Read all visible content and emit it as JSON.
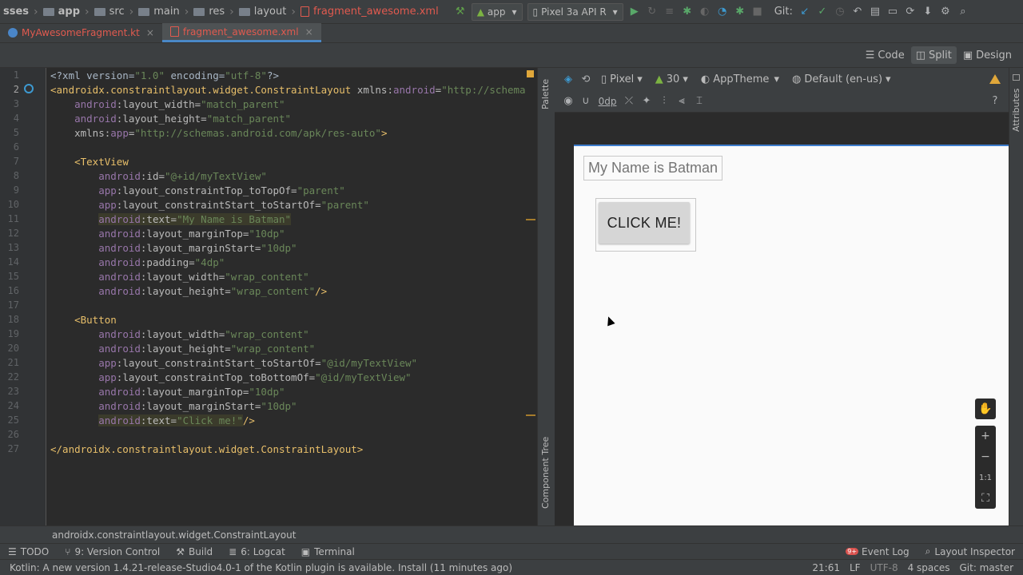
{
  "breadcrumb": [
    "sses",
    "app",
    "src",
    "main",
    "res",
    "layout",
    "fragment_awesome.xml"
  ],
  "toolbar": {
    "run_config": "app",
    "device": "Pixel 3a API R",
    "git_label": "Git:"
  },
  "tabs": [
    {
      "label": "MyAwesomeFragment.kt",
      "active": false
    },
    {
      "label": "fragment_awesome.xml",
      "active": true
    }
  ],
  "view_modes": {
    "code": "Code",
    "split": "Split",
    "design": "Design",
    "active": "Split"
  },
  "code_lines": [
    {
      "n": "1",
      "html": "<span class=\"pl\">&lt;?xml version=</span><span class=\"st\">\"1.0\"</span><span class=\"pl\"> encoding=</span><span class=\"st\">\"utf-8\"</span><span class=\"pl\">?&gt;</span>"
    },
    {
      "n": "2",
      "html": "<span class=\"tg\">&lt;androidx.constraintlayout.widget.ConstraintLayout </span><span class=\"ak\">xmlns:</span><span class=\"an\">android</span><span class=\"ak\">=</span><span class=\"st\">\"http://schemas.android.com/apk/res/android\"</span>"
    },
    {
      "n": "3",
      "html": "    <span class=\"an\">android</span><span class=\"ak\">:layout_width=</span><span class=\"st\">\"match_parent\"</span>"
    },
    {
      "n": "4",
      "html": "    <span class=\"an\">android</span><span class=\"ak\">:layout_height=</span><span class=\"st\">\"match_parent\"</span>"
    },
    {
      "n": "5",
      "html": "    <span class=\"ak\">xmlns:</span><span class=\"an\">app</span><span class=\"ak\">=</span><span class=\"st\">\"http://schemas.android.com/apk/res-auto\"</span><span class=\"tg\">&gt;</span>"
    },
    {
      "n": "6",
      "html": ""
    },
    {
      "n": "7",
      "html": "    <span class=\"tg\">&lt;TextView</span>"
    },
    {
      "n": "8",
      "html": "        <span class=\"an\">android</span><span class=\"ak\">:id=</span><span class=\"st\">\"@+id/myTextView\"</span>"
    },
    {
      "n": "9",
      "html": "        <span class=\"an\">app</span><span class=\"ak\">:layout_constraintTop_toTopOf=</span><span class=\"st\">\"parent\"</span>"
    },
    {
      "n": "10",
      "html": "        <span class=\"an\">app</span><span class=\"ak\">:layout_constraintStart_toStartOf=</span><span class=\"st\">\"parent\"</span>"
    },
    {
      "n": "11",
      "html": "        <span class=\"hl\"><span class=\"an\">android</span><span class=\"ak\">:text=</span><span class=\"st\">\"My Name is Batman\"</span></span>"
    },
    {
      "n": "12",
      "html": "        <span class=\"an\">android</span><span class=\"ak\">:layout_marginTop=</span><span class=\"st\">\"10dp\"</span>"
    },
    {
      "n": "13",
      "html": "        <span class=\"an\">android</span><span class=\"ak\">:layout_marginStart=</span><span class=\"st\">\"10dp\"</span>"
    },
    {
      "n": "14",
      "html": "        <span class=\"an\">android</span><span class=\"ak\">:padding=</span><span class=\"st\">\"4dp\"</span>"
    },
    {
      "n": "15",
      "html": "        <span class=\"an\">android</span><span class=\"ak\">:layout_width=</span><span class=\"st\">\"wrap_content\"</span>"
    },
    {
      "n": "16",
      "html": "        <span class=\"an\">android</span><span class=\"ak\">:layout_height=</span><span class=\"st\">\"wrap_content\"</span><span class=\"tg\">/&gt;</span>"
    },
    {
      "n": "17",
      "html": ""
    },
    {
      "n": "18",
      "html": "    <span class=\"tg\">&lt;Button</span>"
    },
    {
      "n": "19",
      "html": "        <span class=\"an\">android</span><span class=\"ak\">:layout_width=</span><span class=\"st\">\"wrap_content\"</span>"
    },
    {
      "n": "20",
      "html": "        <span class=\"an\">android</span><span class=\"ak\">:layout_height=</span><span class=\"st\">\"wrap_content\"</span>"
    },
    {
      "n": "21",
      "html": "        <span class=\"an\">app</span><span class=\"ak\">:layout_constraintStart_toStartOf=</span><span class=\"st\">\"@id/myTextView\"</span>"
    },
    {
      "n": "22",
      "html": "        <span class=\"an\">app</span><span class=\"ak\">:layout_constraintTop_toBottomOf=</span><span class=\"st\">\"@id/myTextView\"</span>"
    },
    {
      "n": "23",
      "html": "        <span class=\"an\">android</span><span class=\"ak\">:layout_marginTop=</span><span class=\"st\">\"10dp\"</span>"
    },
    {
      "n": "24",
      "html": "        <span class=\"an\">android</span><span class=\"ak\">:layout_marginStart=</span><span class=\"st\">\"10dp\"</span>"
    },
    {
      "n": "25",
      "html": "        <span class=\"hl\"><span class=\"an\">android</span><span class=\"ak\">:text=</span><span class=\"st\">\"Click me!\"</span></span><span class=\"tg\">/&gt;</span>"
    },
    {
      "n": "26",
      "html": ""
    },
    {
      "n": "27",
      "html": "<span class=\"tg\">&lt;/androidx.constraintlayout.widget.ConstraintLayout&gt;</span>"
    }
  ],
  "side_panels": {
    "palette": "Palette",
    "component_tree": "Component Tree",
    "attributes": "Attributes"
  },
  "design_toolbar": {
    "device": "Pixel",
    "api": "30",
    "theme": "AppTheme",
    "locale": "Default (en-us)",
    "margin": "0dp"
  },
  "preview": {
    "text_view": "My Name is Batman",
    "button": "CLICK ME!"
  },
  "zoom_controls": {
    "fit": "1:1"
  },
  "breadcrumb_bottom": "androidx.constraintlayout.widget.ConstraintLayout",
  "tool_windows": [
    {
      "label": "TODO"
    },
    {
      "label": "9: Version Control"
    },
    {
      "label": "Build"
    },
    {
      "label": "6: Logcat"
    },
    {
      "label": "Terminal"
    }
  ],
  "tool_windows_right": [
    {
      "label": "Event Log"
    },
    {
      "label": "Layout Inspector"
    }
  ],
  "event_badge": "9+",
  "status": {
    "message": "Kotlin: A new version 1.4.21-release-Studio4.0-1 of the Kotlin plugin is available. Install (11 minutes ago)",
    "position": "21:61",
    "line_sep": "LF",
    "encoding": "UTF-8",
    "indent": "4 spaces",
    "git": "Git: master"
  },
  "colors": {
    "accent": "#4a88c7",
    "warning": "#e0a73a",
    "xml_file": "#e05a4f"
  }
}
